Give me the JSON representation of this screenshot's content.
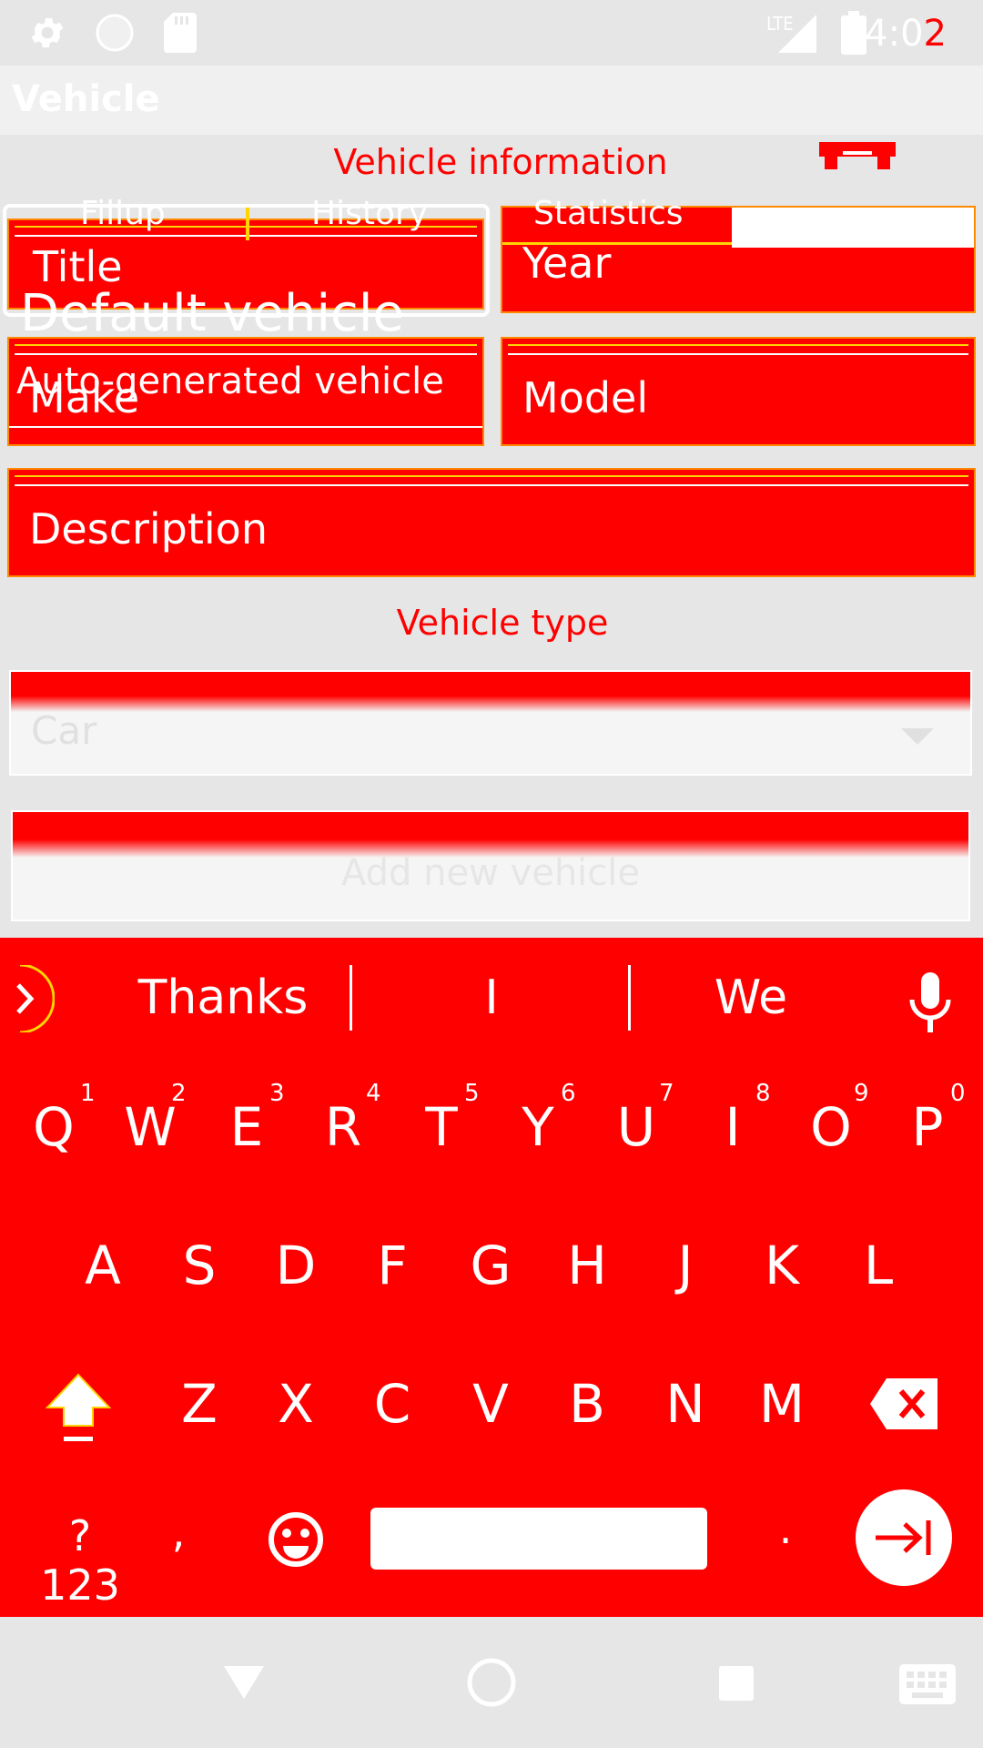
{
  "status_bar": {
    "time": "4:0",
    "time_last_digit": "2",
    "network": "LTE",
    "icons": [
      "gear-icon",
      "circle-icon",
      "sdcard-icon",
      "signal-icon",
      "battery-icon"
    ]
  },
  "toolbar": {
    "title": "Vehicle"
  },
  "vehicle_information": {
    "title": "Vehicle information",
    "tabs": [
      "Fillup",
      "History",
      "Statistics"
    ],
    "side_icon": "car-icon",
    "default_title": "Default vehicle",
    "default_subtitle": "Auto-generated vehicle"
  },
  "fields": {
    "title": "Title",
    "year": "Year",
    "make": "Make",
    "model": "Model",
    "description": "Description"
  },
  "vehicle_type": {
    "title": "Vehicle type",
    "selected": "Car"
  },
  "add_button": {
    "label": "Add new vehicle"
  },
  "keyboard": {
    "suggestions": [
      "Thanks",
      "I",
      "We"
    ],
    "row1": [
      "Q",
      "W",
      "E",
      "R",
      "T",
      "Y",
      "U",
      "I",
      "O",
      "P"
    ],
    "row1_nums": [
      "1",
      "2",
      "3",
      "4",
      "5",
      "6",
      "7",
      "8",
      "9",
      "0"
    ],
    "row2": [
      "A",
      "S",
      "D",
      "F",
      "G",
      "H",
      "J",
      "K",
      "L"
    ],
    "row3": [
      "Z",
      "X",
      "C",
      "V",
      "B",
      "N",
      "M"
    ],
    "symbols_label": "?123",
    "comma": ",",
    "period": "."
  },
  "colors": {
    "accent": "#ff0000",
    "background": "#e6e6e6",
    "white": "#ffffff"
  }
}
